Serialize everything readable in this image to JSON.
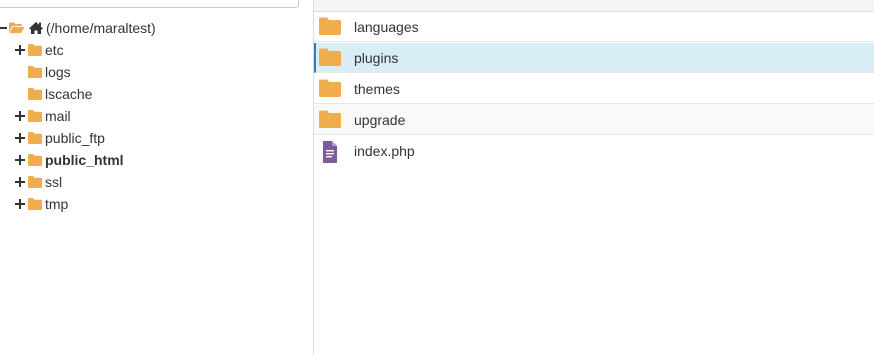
{
  "colors": {
    "folder": "#f0ad4e",
    "selected_row": "#d9edf7",
    "selected_border": "#337ab7",
    "file_icon": "#7d5c9e",
    "text": "#333333"
  },
  "tree": {
    "root": {
      "label": "(/home/maraltest)",
      "icon": "home-icon",
      "toggle": "minus"
    },
    "items": [
      {
        "label": "etc",
        "toggle": "plus",
        "bold": false
      },
      {
        "label": "logs",
        "toggle": "none",
        "bold": false
      },
      {
        "label": "lscache",
        "toggle": "none",
        "bold": false
      },
      {
        "label": "mail",
        "toggle": "plus",
        "bold": false
      },
      {
        "label": "public_ftp",
        "toggle": "plus",
        "bold": false
      },
      {
        "label": "public_html",
        "toggle": "plus",
        "bold": true
      },
      {
        "label": "ssl",
        "toggle": "plus",
        "bold": false
      },
      {
        "label": "tmp",
        "toggle": "plus",
        "bold": false
      }
    ]
  },
  "files": [
    {
      "name": "languages",
      "type": "folder",
      "selected": false
    },
    {
      "name": "plugins",
      "type": "folder",
      "selected": true
    },
    {
      "name": "themes",
      "type": "folder",
      "selected": false
    },
    {
      "name": "upgrade",
      "type": "folder",
      "selected": false
    },
    {
      "name": "index.php",
      "type": "file",
      "selected": false
    }
  ]
}
